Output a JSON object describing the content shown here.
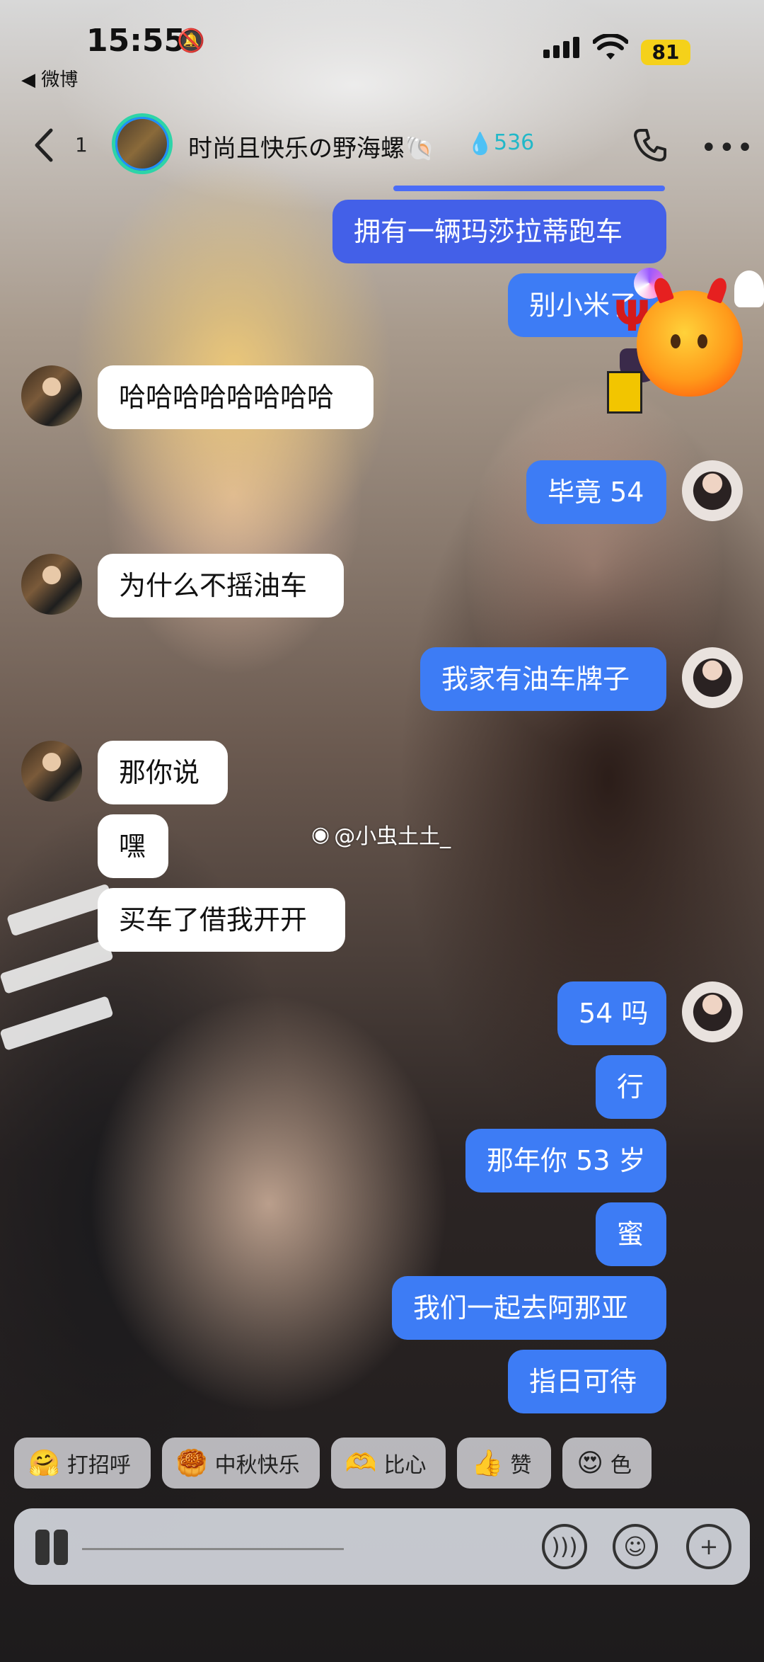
{
  "status_bar": {
    "time": "15:55",
    "back_app": "◀ 微博",
    "battery": "81"
  },
  "header": {
    "unread_count": "1",
    "title": "时尚且快乐の野海螺🐚",
    "score": "536"
  },
  "messages": [
    {
      "side": "out",
      "text": "拥有一辆玛莎拉蒂跑车"
    },
    {
      "side": "out",
      "text": "别小米了"
    },
    {
      "side": "in",
      "text": "哈哈哈哈哈哈哈哈"
    },
    {
      "side": "out",
      "text": "毕竟 54"
    },
    {
      "side": "in",
      "text": "为什么不摇油车"
    },
    {
      "side": "out",
      "text": "我家有油车牌子"
    },
    {
      "side": "in",
      "text": "那你说"
    },
    {
      "side": "in",
      "text": "嘿"
    },
    {
      "side": "in",
      "text": "买车了借我开开"
    },
    {
      "side": "out",
      "text": "54 吗"
    },
    {
      "side": "out",
      "text": "行"
    },
    {
      "side": "out",
      "text": "那年你 53 岁"
    },
    {
      "side": "out",
      "text": "蜜"
    },
    {
      "side": "out",
      "text": "我们一起去阿那亚"
    },
    {
      "side": "out",
      "text": "指日可待"
    }
  ],
  "watermark": "@小虫土土_",
  "quick_replies": [
    {
      "emoji": "🤗",
      "label": "打招呼"
    },
    {
      "emoji": "🥮",
      "label": "中秋快乐"
    },
    {
      "emoji": "🫶",
      "label": "比心"
    },
    {
      "emoji": "👍",
      "label": "赞"
    },
    {
      "emoji": "😍",
      "label": "色"
    }
  ],
  "icons": [
    "back-icon",
    "phone-icon",
    "more-icon",
    "voice-icon",
    "emoji-icon",
    "plus-icon"
  ],
  "colors": {
    "outgoing_bubble": "#3d7cf5",
    "incoming_bubble": "#ffffff",
    "battery": "#f5d11a"
  }
}
